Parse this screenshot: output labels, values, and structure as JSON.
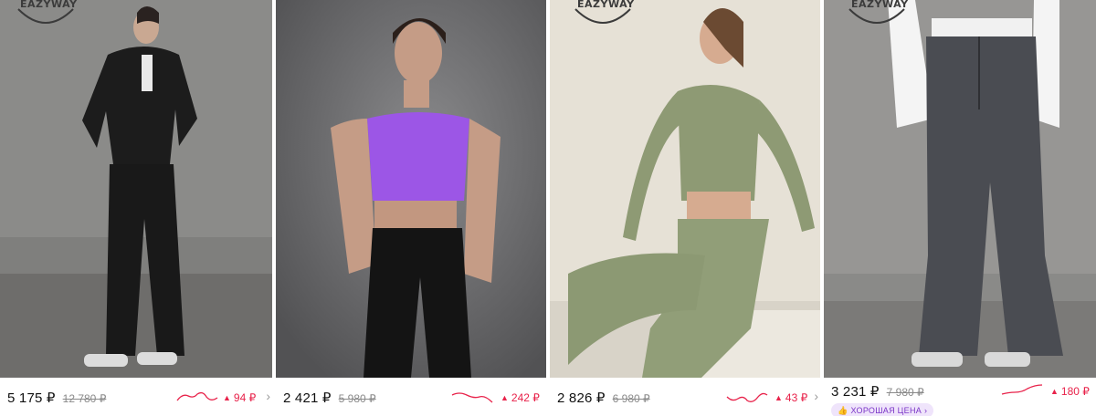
{
  "brand": "EAZYWAY",
  "colors": {
    "accent_red": "#e8224a",
    "badge_bg": "#efe4fb",
    "badge_text": "#7a34c7"
  },
  "products": [
    {
      "price": "5 175 ₽",
      "old_price": "12 780 ₽",
      "delta": "94 ₽",
      "trend_icon": "up-triangle-icon",
      "photo": "black-tracksuit-jumpsuit"
    },
    {
      "price": "2 421 ₽",
      "old_price": "5 980 ₽",
      "delta": "242 ₽",
      "trend_icon": "up-triangle-icon",
      "photo": "purple-sports-top-black-leggings"
    },
    {
      "price": "2 826 ₽",
      "old_price": "6 980 ₽",
      "delta": "43 ₽",
      "trend_icon": "up-triangle-icon",
      "photo": "olive-seamless-set"
    },
    {
      "price": "3 231 ₽",
      "old_price": "7 980 ₽",
      "delta": "180 ₽",
      "trend_icon": "up-triangle-icon",
      "badge": "ХОРОШАЯ ЦЕНА",
      "photo": "grey-wide-leg-pants"
    }
  ]
}
